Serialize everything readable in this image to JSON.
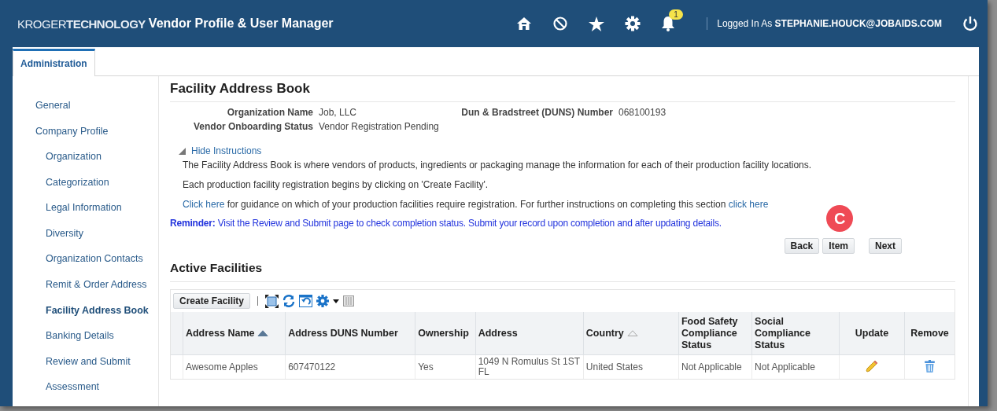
{
  "header": {
    "logo": "KROGER**TECHNOLOGY**",
    "title": "Vendor Profile & User Manager",
    "notification_count": "1",
    "logged_in": "Logged In As **STEPHANIE.HOUCK@JOBAIDS.COM**"
  },
  "tabs": [
    {
      "label": "Administration",
      "selected": true
    }
  ],
  "sidebar": {
    "items": [
      {
        "label": "General",
        "selected": false
      },
      {
        "label": "Company Profile",
        "selected": false,
        "children": [
          {
            "label": "Organization",
            "selected": false
          },
          {
            "label": "Categorization",
            "selected": false
          },
          {
            "label": "Legal Information",
            "selected": false
          },
          {
            "label": "Diversity",
            "selected": false
          },
          {
            "label": "Organization Contacts",
            "selected": false
          },
          {
            "label": "Remit & Order Address",
            "selected": false
          },
          {
            "label": "Facility Address Book",
            "selected": true
          },
          {
            "label": "Banking Details",
            "selected": false
          },
          {
            "label": "Review and Submit",
            "selected": false
          },
          {
            "label": "Assessment",
            "selected": false
          }
        ]
      }
    ]
  },
  "page_title": "Facility Address Book",
  "fields": [
    {
      "label": "Organization Name",
      "value": "Job, LLC"
    },
    {
      "label": "Dun & Bradstreet (DUNS) Number",
      "value": "068100193"
    },
    {
      "label": "Vendor Onboarding Status",
      "value": "Vendor Registration Pending"
    }
  ],
  "instructions": {
    "toggle": "Hide Instructions",
    "expanded": true,
    "paragraphs": [
      [
        {
          "kind": "text",
          "text": "The Facility Address Book is where vendors of products, ingredients or packaging manage the information for each of their production facility locations."
        }
      ],
      [
        {
          "kind": "text",
          "text": "Each production facility registration begins by clicking on 'Create Facility'."
        }
      ],
      [
        {
          "kind": "link",
          "text": "Click here"
        },
        {
          "kind": "text",
          "text": " for guidance on which of your production facilities require registration. For further instructions on completing this section "
        },
        {
          "kind": "link",
          "text": "click here"
        }
      ]
    ]
  },
  "reminder": "**Reminder:** Visit the Review and Submit page to check completion status. Submit your record upon completion and after updating details.",
  "marker": "C",
  "nav_buttons": [
    "Back",
    "Item",
    "Next"
  ],
  "section_title": "Active Facilities",
  "toolbar": {
    "create_button": "Create Facility"
  },
  "table": {
    "columns": [
      {
        "label": "Address Name",
        "sort_arrow": true,
        "sorted": true
      },
      {
        "label": "Address DUNS Number",
        "sort_arrow": false,
        "sorted": false
      },
      {
        "label": "Ownership",
        "sort_arrow": false,
        "sorted": false
      },
      {
        "label": "Address",
        "sort_arrow": false,
        "sorted": false
      },
      {
        "label": "Country",
        "sort_arrow": true,
        "sorted": false
      },
      {
        "label": "Food Safety Compliance Status",
        "sort_arrow": false,
        "sorted": false
      },
      {
        "label": "Social Compliance Status",
        "sort_arrow": false,
        "sorted": false
      },
      {
        "label": "Update",
        "sort_arrow": false,
        "sorted": false
      },
      {
        "label": "Remove",
        "sort_arrow": false,
        "sorted": false
      }
    ],
    "rows": [
      {
        "cells": [
          "Awesome Apples",
          "607470122",
          "Yes",
          "1049 N Romulus St 1ST FL",
          "United States",
          "Not Applicable",
          "Not Applicable"
        ]
      }
    ]
  }
}
